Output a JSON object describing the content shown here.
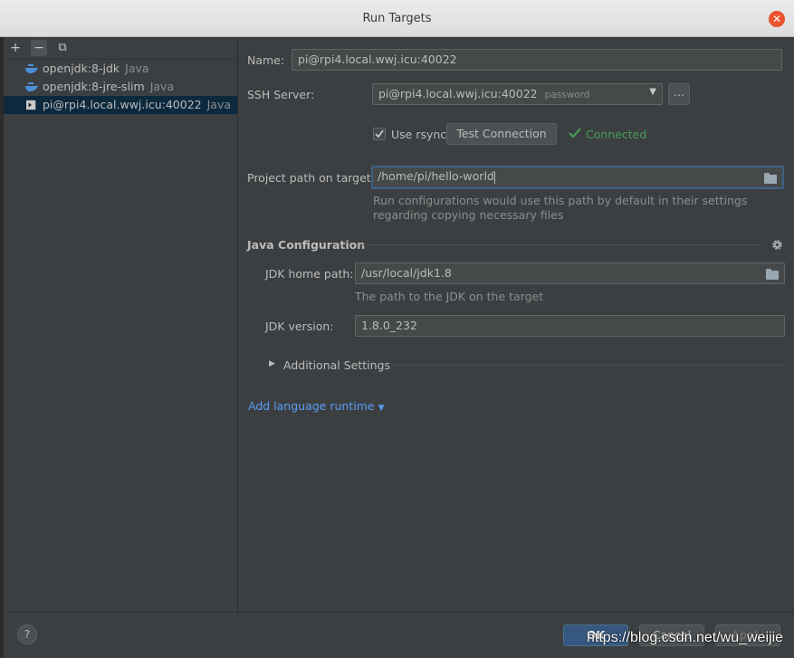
{
  "window": {
    "title": "Run Targets"
  },
  "toolbar": {
    "add": "+",
    "remove": "−",
    "copy": "⧉"
  },
  "targets": [
    {
      "label": "openjdk:8-jdk",
      "type": "Java",
      "icon": "docker-icon"
    },
    {
      "label": "openjdk:8-jre-slim",
      "type": "Java",
      "icon": "docker-icon"
    },
    {
      "label": "pi@rpi4.local.wwj.icu:40022",
      "type": "Java",
      "icon": "ssh-terminal-icon",
      "selected": true
    }
  ],
  "form": {
    "name_label": "Name:",
    "name_value": "pi@rpi4.local.wwj.icu:40022",
    "ssh_label": "SSH Server:",
    "ssh_value": "pi@rpi4.local.wwj.icu:40022",
    "ssh_auth": "password",
    "browse_label": "...",
    "rsync_label": "Use rsync",
    "rsync_checked": true,
    "test_button": "Test Connection",
    "connected": "Connected",
    "project_path_label": "Project path on target:",
    "project_path_value": "/home/pi/hello-world",
    "project_path_hint_1": "Run configurations would use this path by default in their settings",
    "project_path_hint_2": "regarding copying necessary files"
  },
  "java": {
    "section_title": "Java Configuration",
    "jdk_home_label": "JDK home path:",
    "jdk_home_value": "/usr/local/jdk1.8",
    "jdk_home_hint": "The path to the JDK on the target",
    "jdk_version_label": "JDK version:",
    "jdk_version_value": "1.8.0_232",
    "additional_settings": "Additional Settings"
  },
  "add_runtime": "Add language runtime",
  "footer": {
    "help": "?",
    "ok": "OK",
    "cancel": "Cancel",
    "apply": "Apply"
  },
  "watermark": "https://blog.csdn.net/wu_weijie",
  "colors": {
    "accent": "#365880",
    "link": "#589df6",
    "success": "#499c54",
    "close": "#e9542e"
  }
}
